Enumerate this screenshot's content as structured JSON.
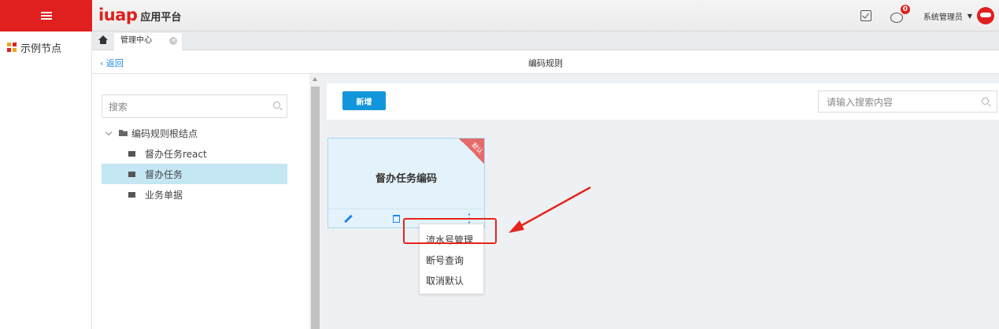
{
  "app": {
    "logo_text": "iuap",
    "logo_sub": "应用平台"
  },
  "sidebar": {
    "items": [
      {
        "label": "示例节点"
      }
    ]
  },
  "header": {
    "user_name": "系统管理员",
    "badge_count": "0"
  },
  "tabs": [
    {
      "label": "管理中心"
    }
  ],
  "page": {
    "back_label": "返回",
    "title": "编码规则"
  },
  "tree": {
    "search_placeholder": "搜索",
    "root": {
      "label": "编码规则根结点"
    },
    "children": [
      {
        "label": "督办任务react",
        "selected": false
      },
      {
        "label": "督办任务",
        "selected": true
      },
      {
        "label": "业务单据",
        "selected": false
      }
    ]
  },
  "toolbar": {
    "add_label": "新增",
    "search_placeholder": "请输入搜索内容"
  },
  "card": {
    "title": "督办任务编码",
    "ribbon": "默认"
  },
  "dropdown": {
    "items": [
      "流水号管理",
      "断号查询",
      "取消默认"
    ]
  },
  "colors": {
    "brand_red": "#e0201e",
    "accent_blue": "#1296db",
    "selected_row": "#c5e6f3",
    "annotation_red": "#e52420"
  }
}
